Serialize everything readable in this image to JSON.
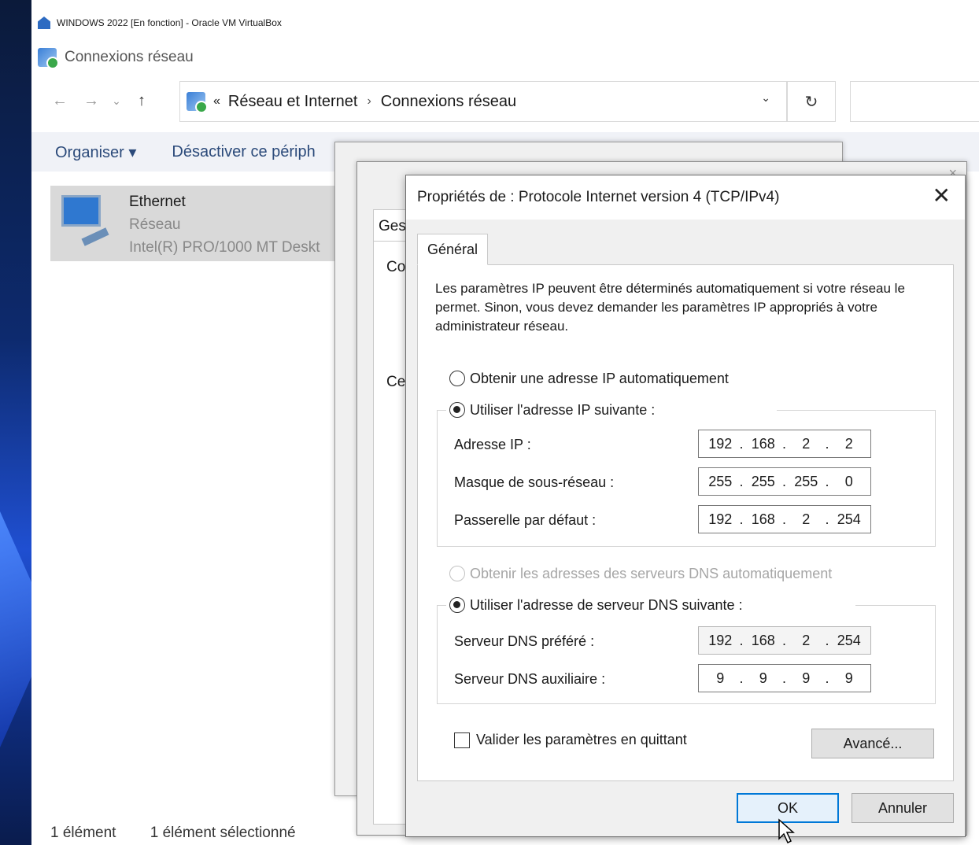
{
  "vm_title": "WINDOWS 2022 [En fonction] - Oracle VM VirtualBox",
  "explorer": {
    "title": "Connexions réseau",
    "nav": {
      "back": "←",
      "forward": "→",
      "recent": "⌄",
      "up": "↑",
      "breadcrumb_prefix": "«",
      "crumb1": "Réseau et Internet",
      "separator": "›",
      "crumb2": "Connexions réseau",
      "dropdown": "⌄",
      "refresh": "↻"
    },
    "command_bar": {
      "organize": "Organiser ▾",
      "disable_device": "Désactiver ce périph"
    },
    "item": {
      "name": "Ethernet",
      "network": "Réseau",
      "adapter": "Intel(R) PRO/1000 MT Deskt"
    },
    "status": {
      "count": "1 élément",
      "selected": "1 élément sélectionné"
    }
  },
  "back_window": {
    "tab_label": "Ges",
    "label_co": "Co",
    "label_ce": "Ce",
    "close": "×"
  },
  "dialog": {
    "title": "Propriétés de : Protocole Internet version 4 (TCP/IPv4)",
    "close": "✕",
    "tab_general": "Général",
    "intro": "Les paramètres IP peuvent être déterminés automatiquement si votre réseau le permet. Sinon, vous devez demander les paramètres IP appropriés à votre administrateur réseau.",
    "ip_auto": "Obtenir une adresse IP automatiquement",
    "ip_manual": "Utiliser l'adresse IP suivante :",
    "ip_address_label": "Adresse IP :",
    "ip_address": [
      "192",
      "168",
      "2",
      "2"
    ],
    "subnet_label": "Masque de sous-réseau :",
    "subnet": [
      "255",
      "255",
      "255",
      "0"
    ],
    "gateway_label": "Passerelle par défaut :",
    "gateway": [
      "192",
      "168",
      "2",
      "254"
    ],
    "dns_auto": "Obtenir les adresses des serveurs DNS automatiquement",
    "dns_manual": "Utiliser l'adresse de serveur DNS suivante :",
    "dns_preferred_label": "Serveur DNS préféré :",
    "dns_preferred": [
      "192",
      "168",
      "2",
      "254"
    ],
    "dns_alternate_label": "Serveur DNS auxiliaire :",
    "dns_alternate": [
      "9",
      "9",
      "9",
      "9"
    ],
    "validate_on_exit": "Valider les paramètres en quittant",
    "advanced": "Avancé...",
    "ok": "OK",
    "cancel": "Annuler"
  }
}
